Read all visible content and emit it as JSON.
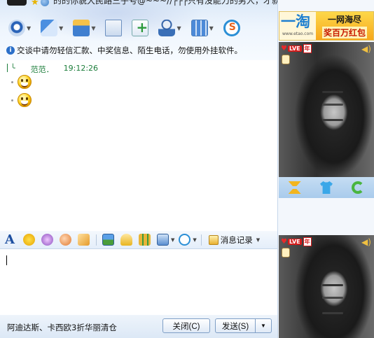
{
  "header": {
    "signature": "的的你貌大民路三乎号@~~~//┌┌┌只有没能力的男人，才就女人现貫。"
  },
  "toolbar": {
    "items": [
      {
        "name": "video-call",
        "icon": "camera-icon"
      },
      {
        "name": "voice-call",
        "icon": "mic-icon"
      },
      {
        "name": "send-file",
        "icon": "folder-icon"
      },
      {
        "name": "send-mail",
        "icon": "mail-icon"
      },
      {
        "name": "create-group",
        "icon": "add-icon"
      },
      {
        "name": "user-info",
        "icon": "user-icon"
      },
      {
        "name": "apps",
        "icon": "apps-icon"
      },
      {
        "name": "sogou",
        "icon": "sogou-icon"
      }
    ]
  },
  "notice": {
    "text": "交谈中请勿轻信汇款、中奖信息、陌生电话，勿使用外挂软件。"
  },
  "chat": {
    "sender": "范范．",
    "time": "19:12:26",
    "messages": [
      {
        "type": "emoticon",
        "icon": "smiley-icon"
      },
      {
        "type": "emoticon",
        "icon": "smiley-icon"
      }
    ]
  },
  "format_bar": {
    "history_label": "消息记录"
  },
  "input": {
    "value": ""
  },
  "bottom": {
    "ad_text": "阿迪达斯、卡西欧3折华丽清仓",
    "close_label": "关闭(C)",
    "send_label": "发送(S)",
    "send_more": "▼"
  },
  "right_panel": {
    "ad": {
      "brand": "一淘",
      "url": "www.etao.com",
      "line1": "一网海尽",
      "line2": "奖百万红包"
    },
    "badge": {
      "level": "LVE",
      "year": "年"
    }
  },
  "colors": {
    "accent": "#2a6fc9",
    "chat_name": "#1b7d3a",
    "ad_yellow": "#f7a81c",
    "ad_red": "#c81a00"
  }
}
